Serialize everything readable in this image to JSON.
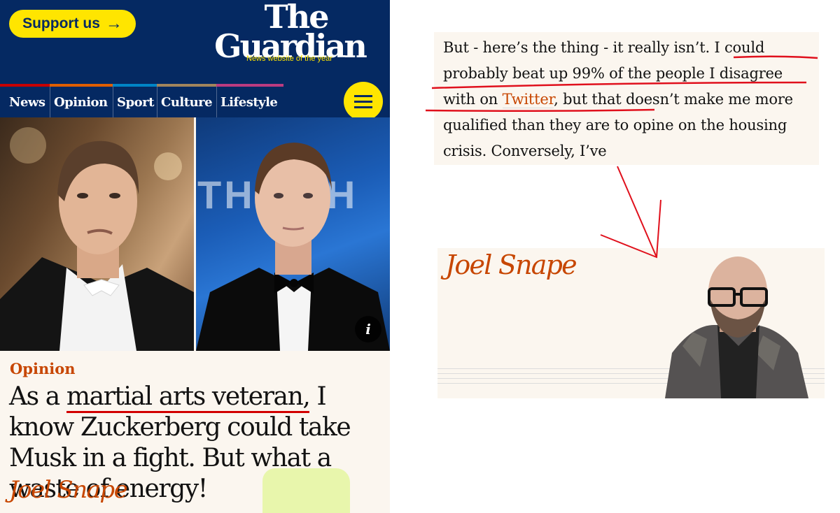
{
  "masthead": {
    "support_label": "Support us",
    "support_icon": "arrow-right-icon",
    "logo_line1": "The",
    "logo_line2": "Guardian",
    "tagline": "News website of the year",
    "brand_color": "#052962",
    "accent_color": "#ffe500"
  },
  "nav": {
    "items": [
      {
        "label": "News",
        "pillar_color": "#c70000"
      },
      {
        "label": "Opinion",
        "pillar_color": "#e05e00"
      },
      {
        "label": "Sport",
        "pillar_color": "#0084c6"
      },
      {
        "label": "Culture",
        "pillar_color": "#a1845c"
      },
      {
        "label": "Lifestyle",
        "pillar_color": "#bb3b80"
      }
    ],
    "menu_icon": "hamburger-menu-icon"
  },
  "hero": {
    "background_text": "THE   SH",
    "caption_button_label": "i"
  },
  "article": {
    "kicker": "Opinion",
    "headline_part1": "As a ",
    "headline_underlined": "martial arts veteran,",
    "headline_part2": " I know Zuckerberg could take Musk in a fight. But what a waste of energy!",
    "byline": "Joel Snape",
    "opinion_color": "#c74600"
  },
  "excerpt": {
    "text_before": "But - here’s the thing - it really isn’t. I could probably beat up 99% of the people I disagree with on ",
    "link_text": "Twitter",
    "text_after": ", but that doesn’t make me more qualified than they are to opine on the housing crisis. Conversely, I’ve"
  },
  "author_card": {
    "name": "Joel Snape"
  },
  "annotation_color": "#e0101c"
}
